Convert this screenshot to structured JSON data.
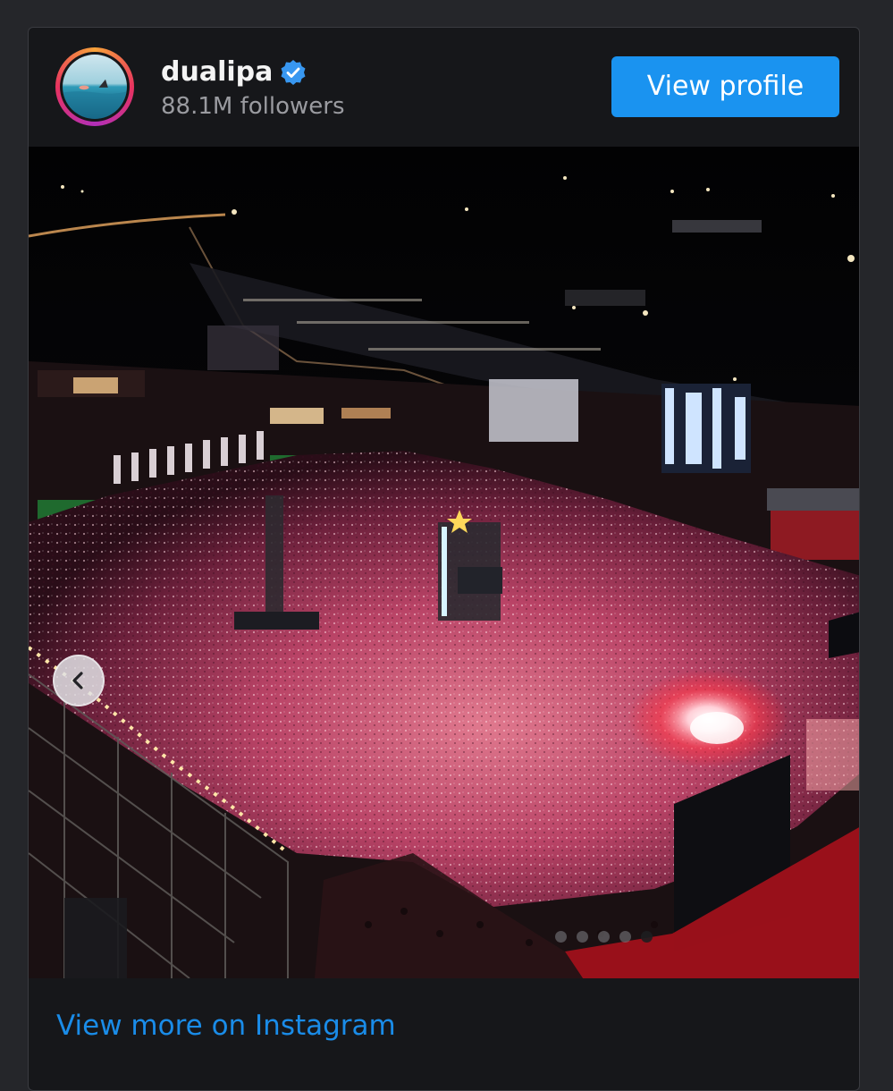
{
  "profile": {
    "username": "dualipa",
    "followers": "88.1M followers",
    "verified": true,
    "avatar_icon": "profile-photo-swimmer"
  },
  "actions": {
    "view_profile_label": "View profile",
    "view_more_label": "View more on Instagram",
    "prev_icon": "chevron-left-icon"
  },
  "carousel": {
    "total_slides": 5,
    "active_index": 4
  },
  "colors": {
    "accent": "#1a93f0",
    "link": "#1a8ce8",
    "card_bg": "#16171a",
    "page_bg": "#25262a"
  }
}
